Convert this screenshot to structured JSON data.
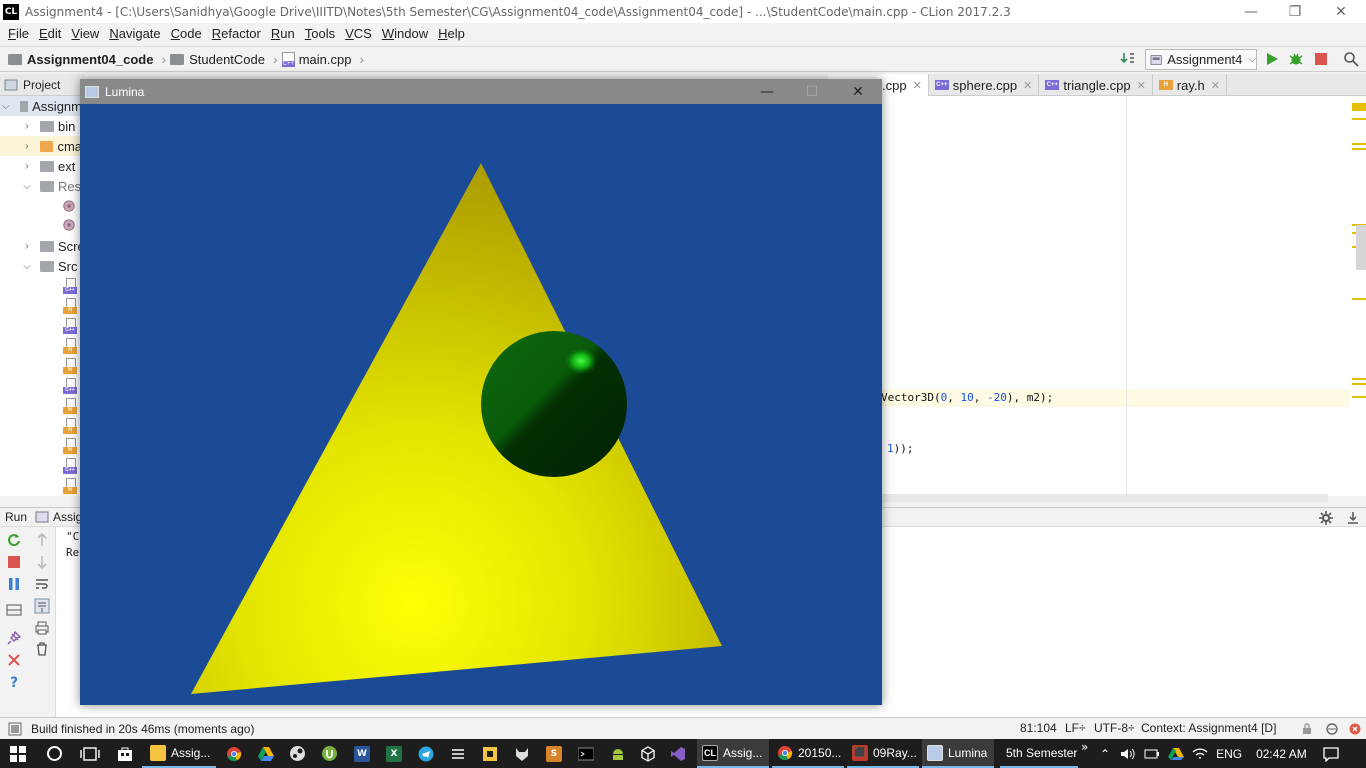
{
  "window": {
    "logo": "CL",
    "title": "Assignment4 - [C:\\Users\\Sanidhya\\Google Drive\\IIITD\\Notes\\5th Semester\\CG\\Assignment04_code\\Assignment04_code] - ...\\StudentCode\\main.cpp - CLion 2017.2.3",
    "minimize": "—",
    "restore": "❐",
    "close": "✕"
  },
  "menu": {
    "items": [
      {
        "u": "F",
        "rest": "ile"
      },
      {
        "u": "E",
        "rest": "dit"
      },
      {
        "u": "V",
        "rest": "iew"
      },
      {
        "u": "N",
        "rest": "avigate"
      },
      {
        "u": "C",
        "rest": "ode"
      },
      {
        "u": "R",
        "rest": "efactor"
      },
      {
        "u": "R",
        "rest": "un"
      },
      {
        "u": "T",
        "rest": "ools"
      },
      {
        "u": "V",
        "rest": "CS"
      },
      {
        "u": "W",
        "rest": "indow"
      },
      {
        "u": "H",
        "rest": "elp"
      }
    ]
  },
  "breadcrumbs": {
    "root": "Assignment04_code",
    "folder": "StudentCode",
    "file": "main.cpp"
  },
  "toolbar": {
    "run_config": "Assignment4"
  },
  "project": {
    "header": "Project",
    "tree": {
      "root": "Assignm",
      "bin": "bin",
      "cmake": "cma",
      "ext": "ext",
      "res": "Res",
      "screen": "Scre",
      "src": "Src"
    }
  },
  "editor": {
    "tabs": [
      {
        "label": ".cpp",
        "type": "cpp",
        "active": true
      },
      {
        "label": "sphere.cpp",
        "type": "cpp"
      },
      {
        "label": "triangle.cpp",
        "type": "cpp"
      },
      {
        "label": "ray.h",
        "type": "h"
      }
    ],
    "line1_prefix": "Vector3D(",
    "line1_n1": "0",
    "line1_c1": ", ",
    "line1_n2": "10",
    "line1_c2": ", ",
    "line1_n3": "-20",
    "line1_suffix": "), m2);",
    "line2_n": "1",
    "line2_suffix": "));"
  },
  "run": {
    "tab": "Run",
    "config": "Assign",
    "out1": "\"C",
    "out2": "Re"
  },
  "status": {
    "message": "Build finished in 20s 46ms (moments ago)",
    "position": "81:104",
    "line_sep": "LF÷",
    "encoding": "UTF-8÷",
    "context": "Context: Assignment4 [D]"
  },
  "lumina": {
    "title": "Lumina",
    "background": "#1b4b96",
    "triangle_color": "#e6e600",
    "sphere_color": "#0a5a0a"
  },
  "taskbar": {
    "items": [
      {
        "label": "Assig...",
        "icon": "explorer-icon"
      },
      {
        "label": "Assig...",
        "icon": "clion-icon"
      },
      {
        "label": "20150...",
        "icon": "chrome-icon"
      },
      {
        "label": "09Ray...",
        "icon": "pdf-icon"
      },
      {
        "label": "Lumina",
        "icon": "lumina-icon"
      },
      {
        "label": "5th Semester",
        "icon": "folder-icon"
      }
    ],
    "language": "ENG",
    "clock": "02:42 AM"
  }
}
